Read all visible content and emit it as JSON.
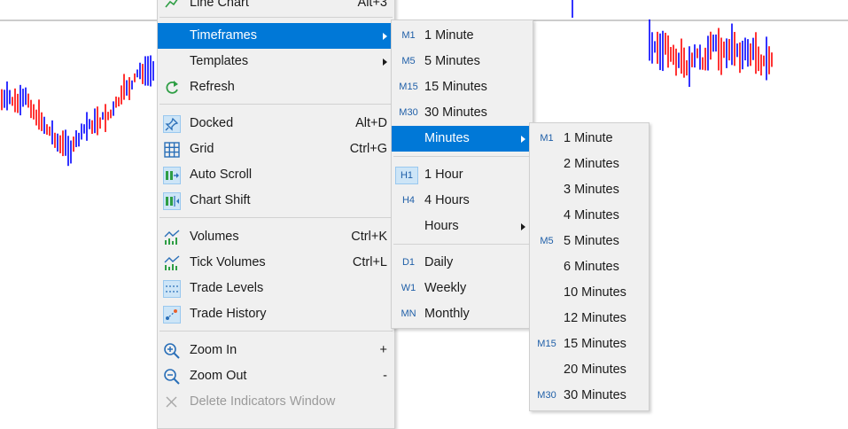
{
  "main_menu": {
    "items": [
      {
        "label": "Line Chart",
        "shortcut": "Alt+3",
        "icon": "line-chart-icon"
      },
      {
        "label": "Timeframes",
        "submenu": true,
        "highlighted": true
      },
      {
        "label": "Templates",
        "submenu": true
      },
      {
        "label": "Refresh",
        "icon": "refresh-icon"
      },
      {
        "label": "Docked",
        "shortcut": "Alt+D",
        "icon": "pin-icon"
      },
      {
        "label": "Grid",
        "shortcut": "Ctrl+G",
        "icon": "grid-icon"
      },
      {
        "label": "Auto Scroll",
        "icon": "auto-scroll-icon"
      },
      {
        "label": "Chart Shift",
        "icon": "chart-shift-icon"
      },
      {
        "label": "Volumes",
        "shortcut": "Ctrl+K",
        "icon": "volumes-icon"
      },
      {
        "label": "Tick Volumes",
        "shortcut": "Ctrl+L",
        "icon": "tick-volumes-icon"
      },
      {
        "label": "Trade Levels",
        "icon": "trade-levels-icon"
      },
      {
        "label": "Trade History",
        "icon": "trade-history-icon"
      },
      {
        "label": "Zoom In",
        "shortcut": "+",
        "icon": "zoom-in-icon"
      },
      {
        "label": "Zoom Out",
        "shortcut": "-",
        "icon": "zoom-out-icon"
      },
      {
        "label": "Delete Indicators Window",
        "icon": "delete-icon",
        "disabled": true
      }
    ]
  },
  "timeframes_menu": {
    "items": [
      {
        "code": "M1",
        "label": "1 Minute"
      },
      {
        "code": "M5",
        "label": "5 Minutes"
      },
      {
        "code": "M15",
        "label": "15 Minutes"
      },
      {
        "code": "M30",
        "label": "30 Minutes"
      },
      {
        "code": "",
        "label": "Minutes",
        "submenu": true,
        "highlighted": true
      },
      {
        "code": "H1",
        "label": "1 Hour",
        "boxed": true
      },
      {
        "code": "H4",
        "label": "4 Hours"
      },
      {
        "code": "",
        "label": "Hours",
        "submenu": true
      },
      {
        "code": "D1",
        "label": "Daily"
      },
      {
        "code": "W1",
        "label": "Weekly"
      },
      {
        "code": "MN",
        "label": "Monthly"
      }
    ]
  },
  "minutes_menu": {
    "items": [
      {
        "code": "M1",
        "label": "1 Minute"
      },
      {
        "code": "",
        "label": "2 Minutes"
      },
      {
        "code": "",
        "label": "3 Minutes"
      },
      {
        "code": "",
        "label": "4 Minutes"
      },
      {
        "code": "M5",
        "label": "5 Minutes"
      },
      {
        "code": "",
        "label": "6 Minutes"
      },
      {
        "code": "",
        "label": "10 Minutes"
      },
      {
        "code": "",
        "label": "12 Minutes"
      },
      {
        "code": "M15",
        "label": "15 Minutes"
      },
      {
        "code": "",
        "label": "20 Minutes"
      },
      {
        "code": "M30",
        "label": "30 Minutes"
      }
    ]
  },
  "colors": {
    "bull": "#0000ff",
    "bear": "#ff0000",
    "highlight": "#0078d7",
    "code_text": "#1f5fa8"
  }
}
